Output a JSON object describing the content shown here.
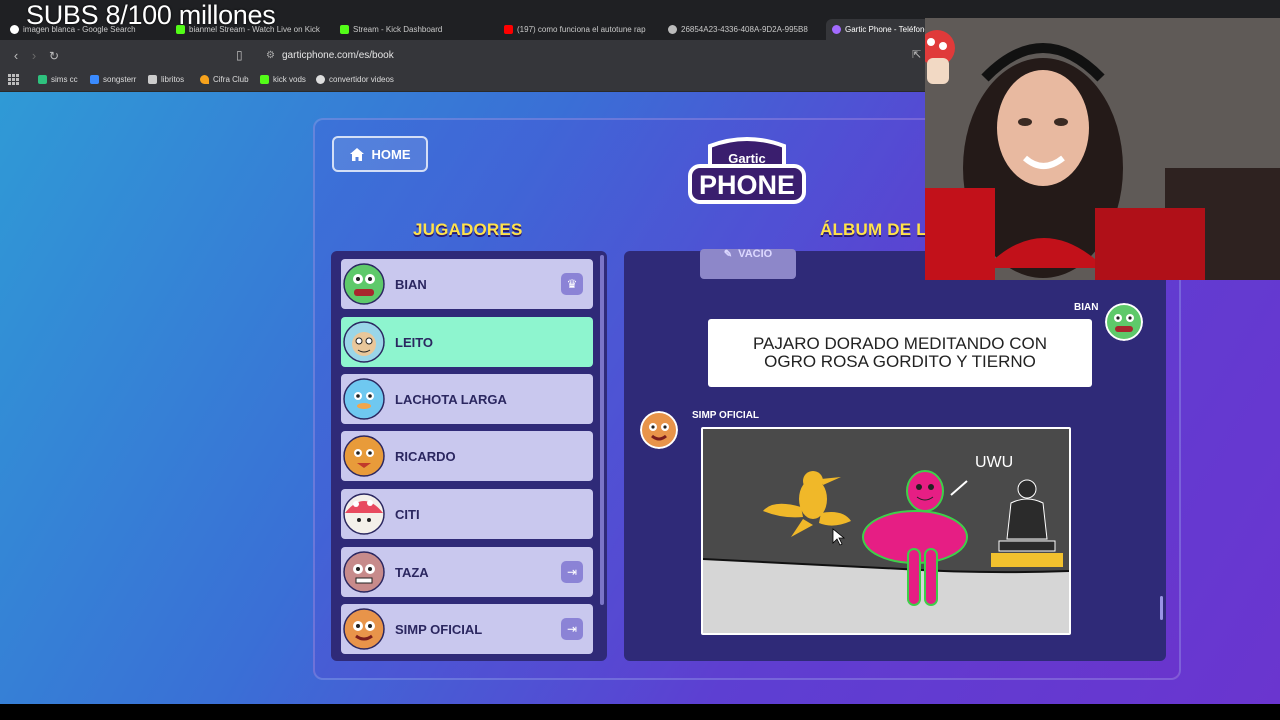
{
  "overlay": {
    "title": "SUBS 8/100 millones"
  },
  "browser": {
    "tabs": [
      {
        "label": "imagen blanca - Google Search",
        "color": "#ffffff"
      },
      {
        "label": "bianmel Stream - Watch Live on Kick",
        "color": "#53fc18"
      },
      {
        "label": "Stream - Kick Dashboard",
        "color": "#53fc18"
      },
      {
        "label": "(197) como funciona el autotune rap",
        "color": "#ff0000"
      },
      {
        "label": "26854A23-4336-408A-9D2A-995B8",
        "color": "#bbbbbb"
      },
      {
        "label": "Gartic Phone - Teléfono",
        "color": "#a36bff"
      }
    ],
    "url": "garticphone.com/es/book",
    "bookmarks": [
      {
        "label": "sims cc",
        "color": "#2ec27e"
      },
      {
        "label": "songsterr",
        "color": "#3a8bff"
      },
      {
        "label": "libritos",
        "color": "#cccccc"
      },
      {
        "label": "Cifra Club",
        "color": "#f6a21c"
      },
      {
        "label": "kick vods",
        "color": "#53fc18"
      },
      {
        "label": "convertidor videos",
        "color": "#dddddd"
      }
    ]
  },
  "game": {
    "home_label": "HOME",
    "logo_top": "Gartic",
    "logo_bottom": "PHONE",
    "players_title": "JUGADORES",
    "album_title": "ÁLBUM DE L",
    "players": [
      {
        "name": "BIAN",
        "state": "host",
        "avatar_color": "#5ec96a"
      },
      {
        "name": "LEITO",
        "state": "active",
        "avatar_color": "#9ad6e8"
      },
      {
        "name": "LACHOTA LARGA",
        "state": "normal",
        "avatar_color": "#6fc8f0"
      },
      {
        "name": "RICARDO",
        "state": "normal",
        "avatar_color": "#e89b3a"
      },
      {
        "name": "CITI",
        "state": "normal",
        "avatar_color": "#e84a5f"
      },
      {
        "name": "TAZA",
        "state": "left",
        "avatar_color": "#c78b8b"
      },
      {
        "name": "SIMP OFICIAL",
        "state": "left",
        "avatar_color": "#e8944a"
      }
    ],
    "album": {
      "vacio_label": "VACIO",
      "text_author": "BIAN",
      "text_line1": "PAJARO DORADO MEDITANDO CON",
      "text_line2": "OGRO ROSA GORDITO Y TIERNO",
      "drawing_author": "SIMP OFICIAL",
      "drawing_text": "UWU"
    }
  },
  "colors": {
    "accent_yellow": "#ffe24a",
    "active_player": "#8ef5cf",
    "panel": "#2f2a78"
  }
}
